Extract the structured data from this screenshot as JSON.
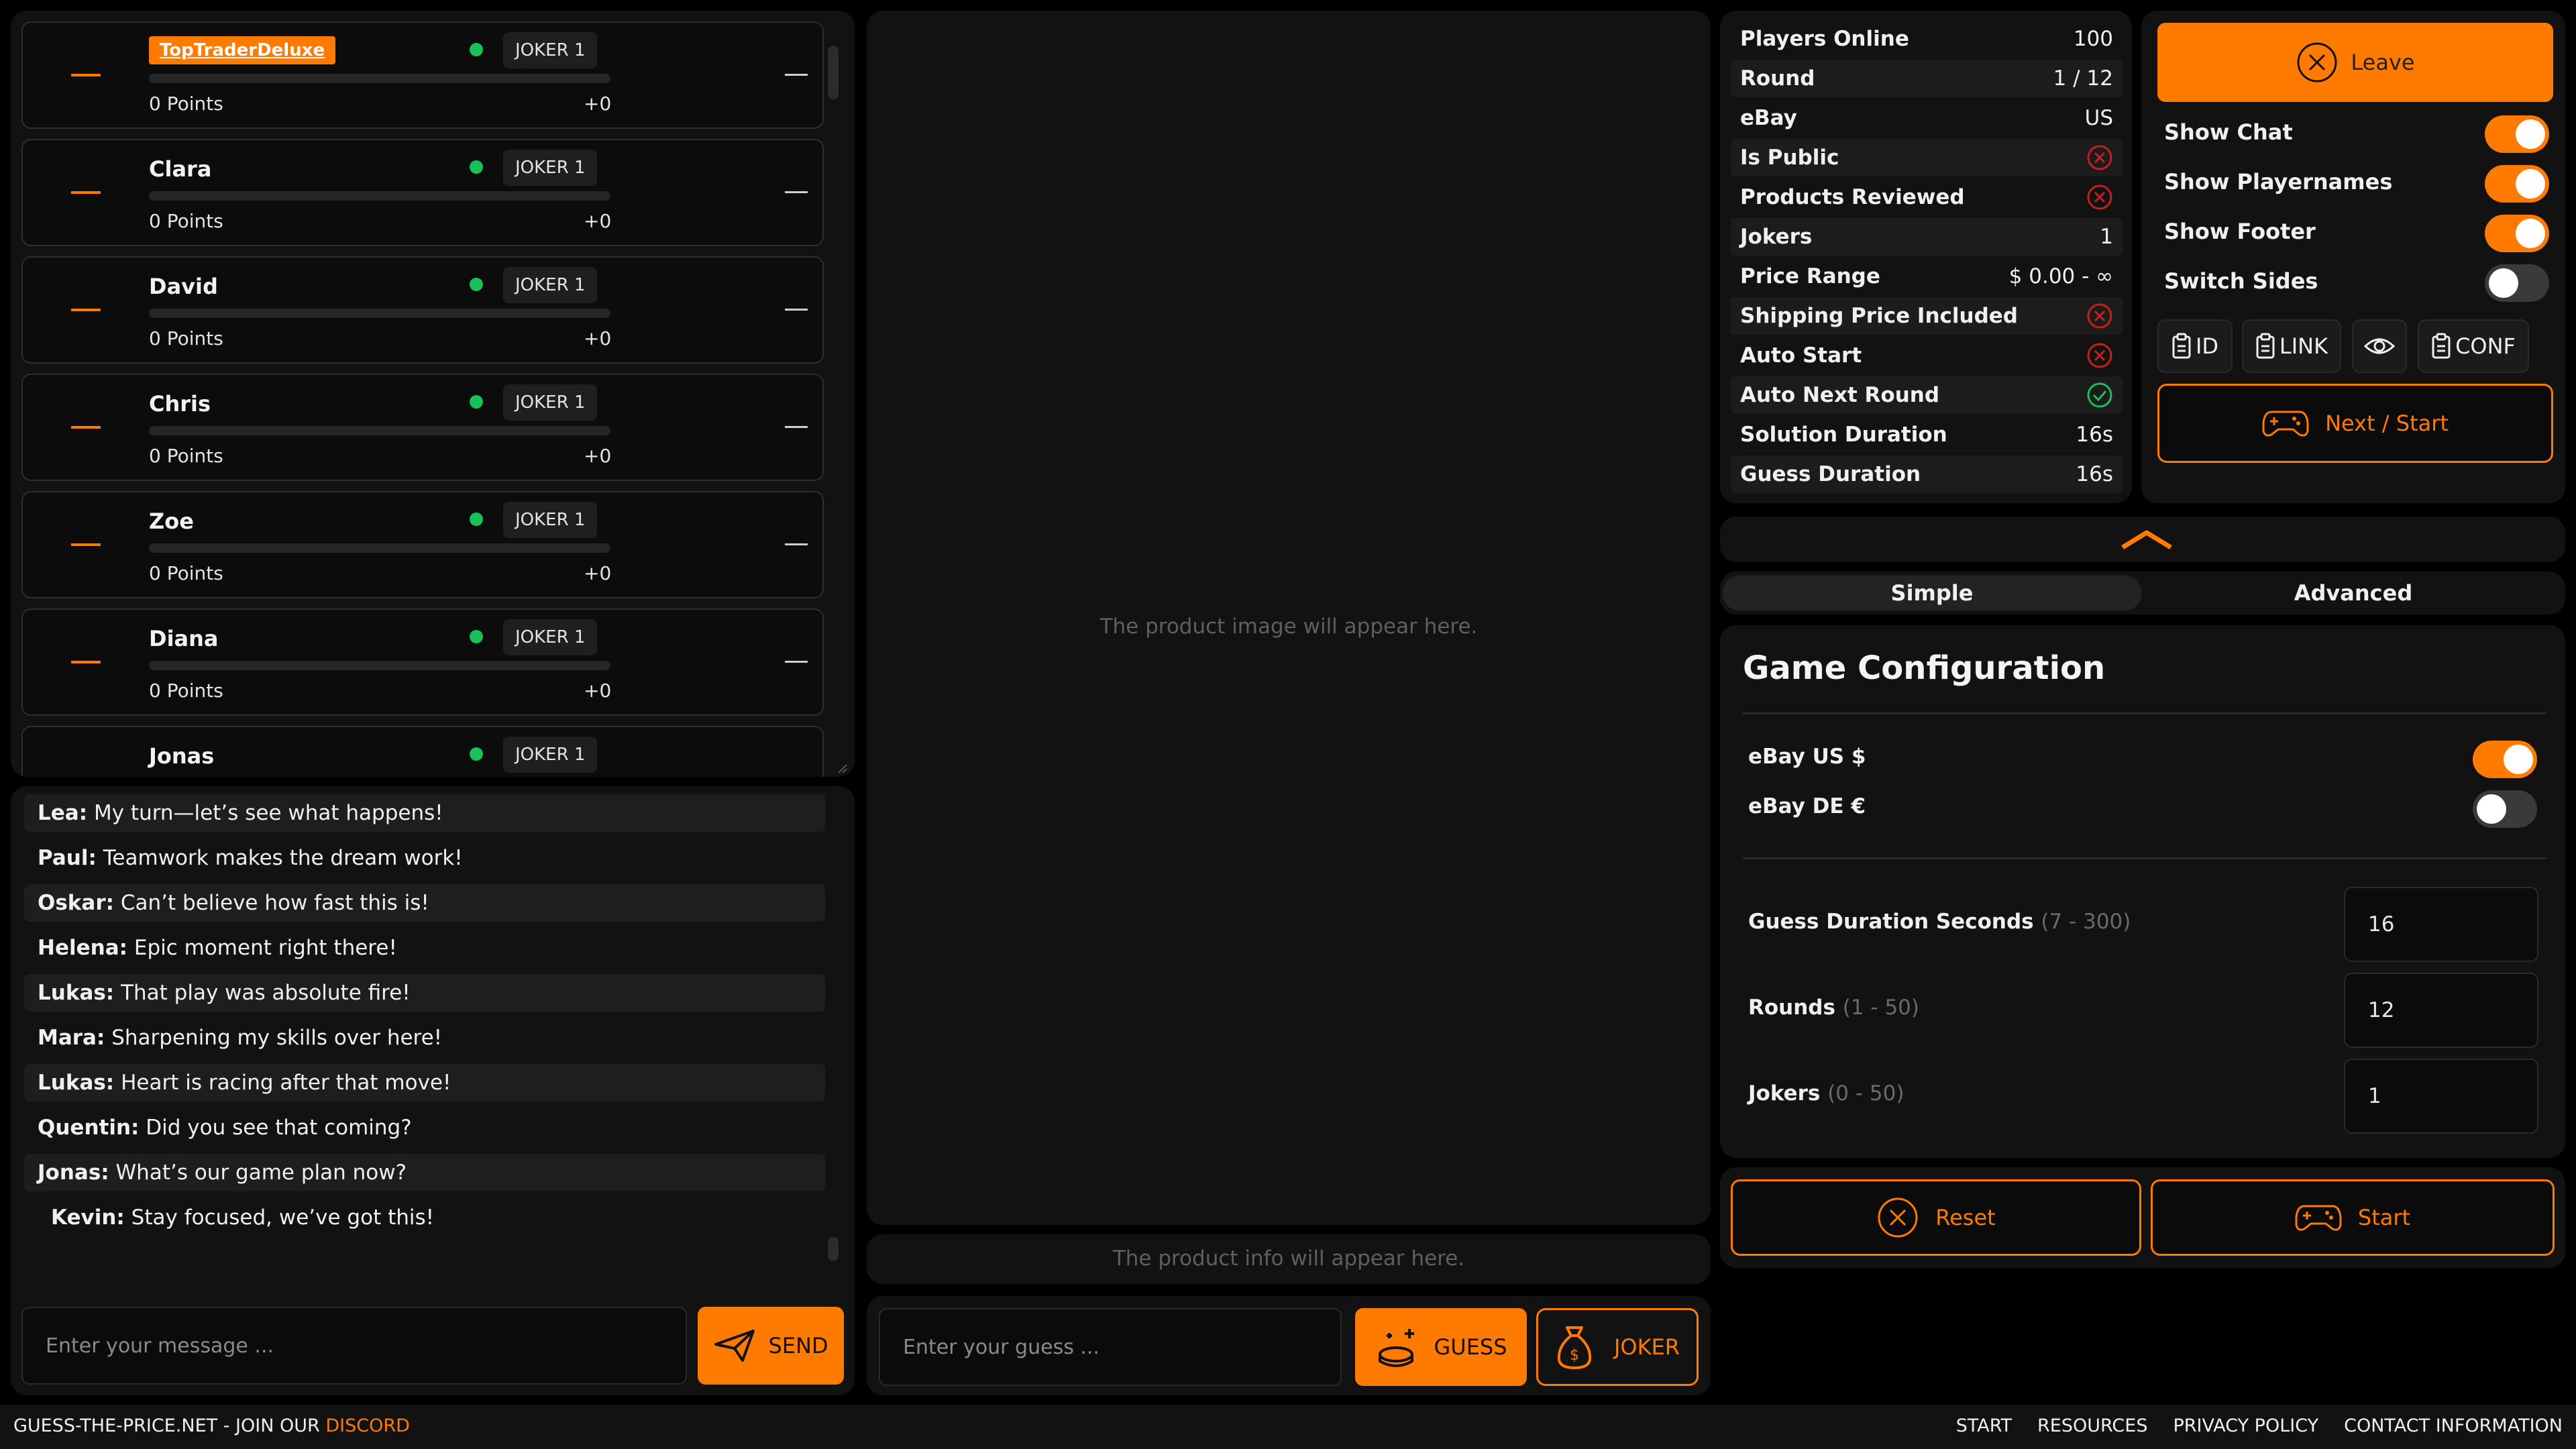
{
  "players": [
    {
      "name": "TopTraderDeluxe",
      "is_self": true,
      "joker": "JOKER 1",
      "points": "0 Points",
      "delta": "+0"
    },
    {
      "name": "Clara",
      "is_self": false,
      "joker": "JOKER 1",
      "points": "0 Points",
      "delta": "+0"
    },
    {
      "name": "David",
      "is_self": false,
      "joker": "JOKER 1",
      "points": "0 Points",
      "delta": "+0"
    },
    {
      "name": "Chris",
      "is_self": false,
      "joker": "JOKER 1",
      "points": "0 Points",
      "delta": "+0"
    },
    {
      "name": "Zoe",
      "is_self": false,
      "joker": "JOKER 1",
      "points": "0 Points",
      "delta": "+0"
    },
    {
      "name": "Diana",
      "is_self": false,
      "joker": "JOKER 1",
      "points": "0 Points",
      "delta": "+0"
    },
    {
      "name": "Jonas",
      "is_self": false,
      "joker": "JOKER 1",
      "points": "",
      "delta": ""
    }
  ],
  "chat": {
    "messages": [
      {
        "author": "Lea:",
        "text": " My turn—let’s see what happens!"
      },
      {
        "author": "Paul:",
        "text": " Teamwork makes the dream work!"
      },
      {
        "author": "Oskar:",
        "text": " Can’t believe how fast this is!"
      },
      {
        "author": "Helena:",
        "text": " Epic moment right there!"
      },
      {
        "author": "Lukas:",
        "text": " That play was absolute fire!"
      },
      {
        "author": "Mara:",
        "text": " Sharpening my skills over here!"
      },
      {
        "author": "Lukas:",
        "text": " Heart is racing after that move!"
      },
      {
        "author": "Quentin:",
        "text": " Did you see that coming?"
      },
      {
        "author": "Jonas:",
        "text": " What’s our game plan now?"
      },
      {
        "author": "Kevin:",
        "text": " Stay focused, we’ve got this!"
      }
    ],
    "input_placeholder": "Enter your message ...",
    "send_label": "SEND"
  },
  "product": {
    "image_placeholder": "The product image will appear here.",
    "info_placeholder": "The product info will appear here."
  },
  "guess": {
    "input_placeholder": "Enter your guess ...",
    "guess_label": "GUESS",
    "joker_label": "JOKER"
  },
  "stats": [
    {
      "label": "Players Online",
      "value": "100",
      "status": null
    },
    {
      "label": "Round",
      "value": "1 / 12",
      "status": null
    },
    {
      "label": "eBay",
      "value": "US",
      "status": null
    },
    {
      "label": "Is Public",
      "value": null,
      "status": "no"
    },
    {
      "label": "Products Reviewed",
      "value": null,
      "status": "no"
    },
    {
      "label": "Jokers",
      "value": "1",
      "status": null
    },
    {
      "label": "Price Range",
      "value": "$ 0.00 - ∞",
      "status": null
    },
    {
      "label": "Shipping Price Included",
      "value": null,
      "status": "no"
    },
    {
      "label": "Auto Start",
      "value": null,
      "status": "no"
    },
    {
      "label": "Auto Next Round",
      "value": null,
      "status": "yes"
    },
    {
      "label": "Solution Duration",
      "value": "16s",
      "status": null
    },
    {
      "label": "Guess Duration",
      "value": "16s",
      "status": null
    }
  ],
  "controls": {
    "leave_label": "Leave",
    "toggles": [
      {
        "label": "Show Chat",
        "on": true
      },
      {
        "label": "Show Playernames",
        "on": true
      },
      {
        "label": "Show Footer",
        "on": true
      },
      {
        "label": "Switch Sides",
        "on": false
      }
    ],
    "id_label": "ID",
    "link_label": "LINK",
    "conf_label": "CONF",
    "next_start_label": "Next / Start"
  },
  "tabs": [
    {
      "label": "Simple",
      "active": true
    },
    {
      "label": "Advanced",
      "active": false
    }
  ],
  "config": {
    "title": "Game Configuration",
    "markets": [
      {
        "label": "eBay US $",
        "on": true
      },
      {
        "label": "eBay DE €",
        "on": false
      }
    ],
    "fields": [
      {
        "label": "Guess Duration Seconds",
        "range": "(7 - 300)",
        "value": "16"
      },
      {
        "label": "Rounds",
        "range": "(1 - 50)",
        "value": "12"
      },
      {
        "label": "Jokers",
        "range": "(0 - 50)",
        "value": "1"
      }
    ],
    "reset_label": "Reset",
    "start_label": "Start"
  },
  "footer": {
    "site": "GUESS-THE-PRICE.NET - JOIN OUR ",
    "discord": "DISCORD",
    "links": [
      "START",
      "RESOURCES",
      "PRIVACY POLICY",
      "CONTACT INFORMATION"
    ]
  },
  "colors": {
    "accent": "#ff7a00",
    "online": "#18c05a",
    "no": "#d22",
    "yes": "#18c05a"
  }
}
